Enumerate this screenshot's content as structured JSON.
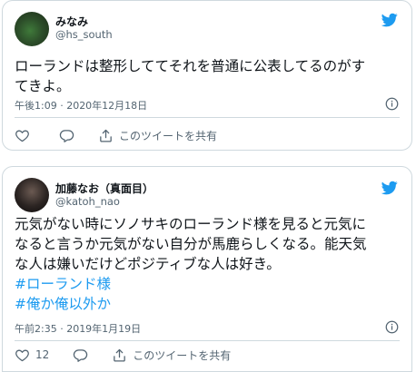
{
  "tweets": [
    {
      "display_name": "みなみ",
      "handle": "@hs_south",
      "text_lines": [
        {
          "text": "ローランドは整形しててそれを普通に公表してるのがす",
          "hashtag": false
        },
        {
          "text": "てきよ。",
          "hashtag": false
        }
      ],
      "timestamp": "午後1:09 · 2020年12月18日",
      "like_count": "",
      "share_label": "このツイートを共有"
    },
    {
      "display_name": "加藤なお（真面目）",
      "handle": "@katoh_nao",
      "text_lines": [
        {
          "text": "元気がない時にソノサキのローランド様を見ると元気に",
          "hashtag": false
        },
        {
          "text": "なると言うか元気がない自分が馬鹿らしくなる。能天気",
          "hashtag": false
        },
        {
          "text": "な人は嫌いだけどポジティブな人は好き。",
          "hashtag": false
        },
        {
          "text": "#ローランド様",
          "hashtag": true
        },
        {
          "text": "#俺か俺以外か",
          "hashtag": true
        }
      ],
      "timestamp": "午前2:35 · 2019年1月19日",
      "like_count": "12",
      "share_label": "このツイートを共有"
    }
  ],
  "icons": {
    "brand": "twitter-bird-icon",
    "info": "info-icon",
    "like": "heart-icon",
    "reply": "reply-bubble-icon",
    "share": "share-upload-icon"
  },
  "colors": {
    "brand_blue": "#1d9bf0",
    "text": "#0f1419",
    "secondary": "#536471",
    "border": "#cfd9de"
  }
}
